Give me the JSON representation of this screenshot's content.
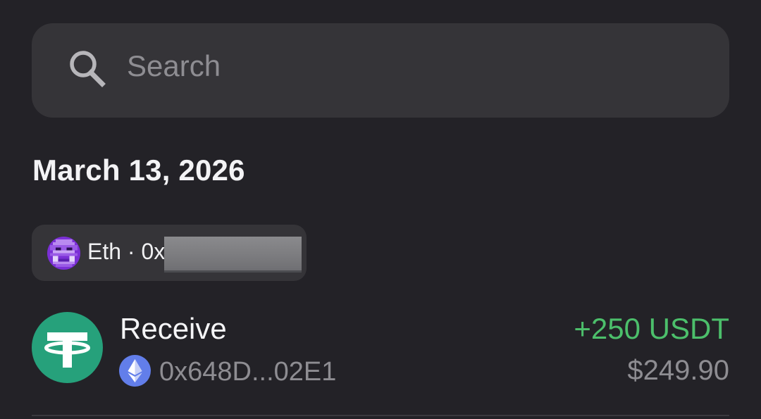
{
  "search": {
    "placeholder": "Search",
    "icon": "search-icon"
  },
  "date_heading": "March 13, 2026",
  "wallet": {
    "label": "Eth · 0x",
    "avatar_icon": "pixel-avatar-icon",
    "avatar_color": "#7b2fd6"
  },
  "transaction": {
    "type": "Receive",
    "token_icon": "tether-icon",
    "token_color": "#26a17b",
    "chain_icon": "ethereum-icon",
    "chain_color": "#627eea",
    "address": "0x648D...02E1",
    "amount": "+250 USDT",
    "amount_color": "#4cbf6b",
    "fiat_value": "$249.90"
  },
  "colors": {
    "background": "#232227",
    "surface": "#353438",
    "muted_text": "#8e8d92"
  }
}
